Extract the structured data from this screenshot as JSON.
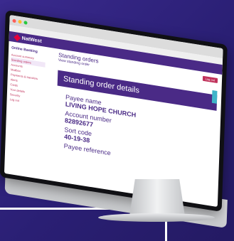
{
  "brand": {
    "name": "NatWest"
  },
  "sidebar": {
    "heading": "Online Banking",
    "items": [
      {
        "label": "Account summary"
      },
      {
        "label": "Standing orders"
      },
      {
        "label": "Accounts"
      },
      {
        "label": "Mailbox"
      },
      {
        "label": "Payments & transfers"
      },
      {
        "label": "Alerts"
      },
      {
        "label": "Cards"
      },
      {
        "label": "Your details"
      },
      {
        "label": "Security"
      },
      {
        "label": "Log out"
      }
    ]
  },
  "page": {
    "title": "Standing orders",
    "subtitle": "View standing order",
    "logout_label": "Log out"
  },
  "panel": {
    "title": "Standing order details"
  },
  "details": {
    "payee_name_label": "Payee name",
    "payee_name_value": "LIVING HOPE CHURCH",
    "account_number_label": "Account number",
    "account_number_value": "82892677",
    "sort_code_label": "Sort code",
    "sort_code_value": "40-19-38",
    "payee_reference_label": "Payee reference"
  },
  "colors": {
    "brand_purple": "#4a2a86",
    "accent_pink": "#c0315a",
    "background": "#2a1f74"
  }
}
